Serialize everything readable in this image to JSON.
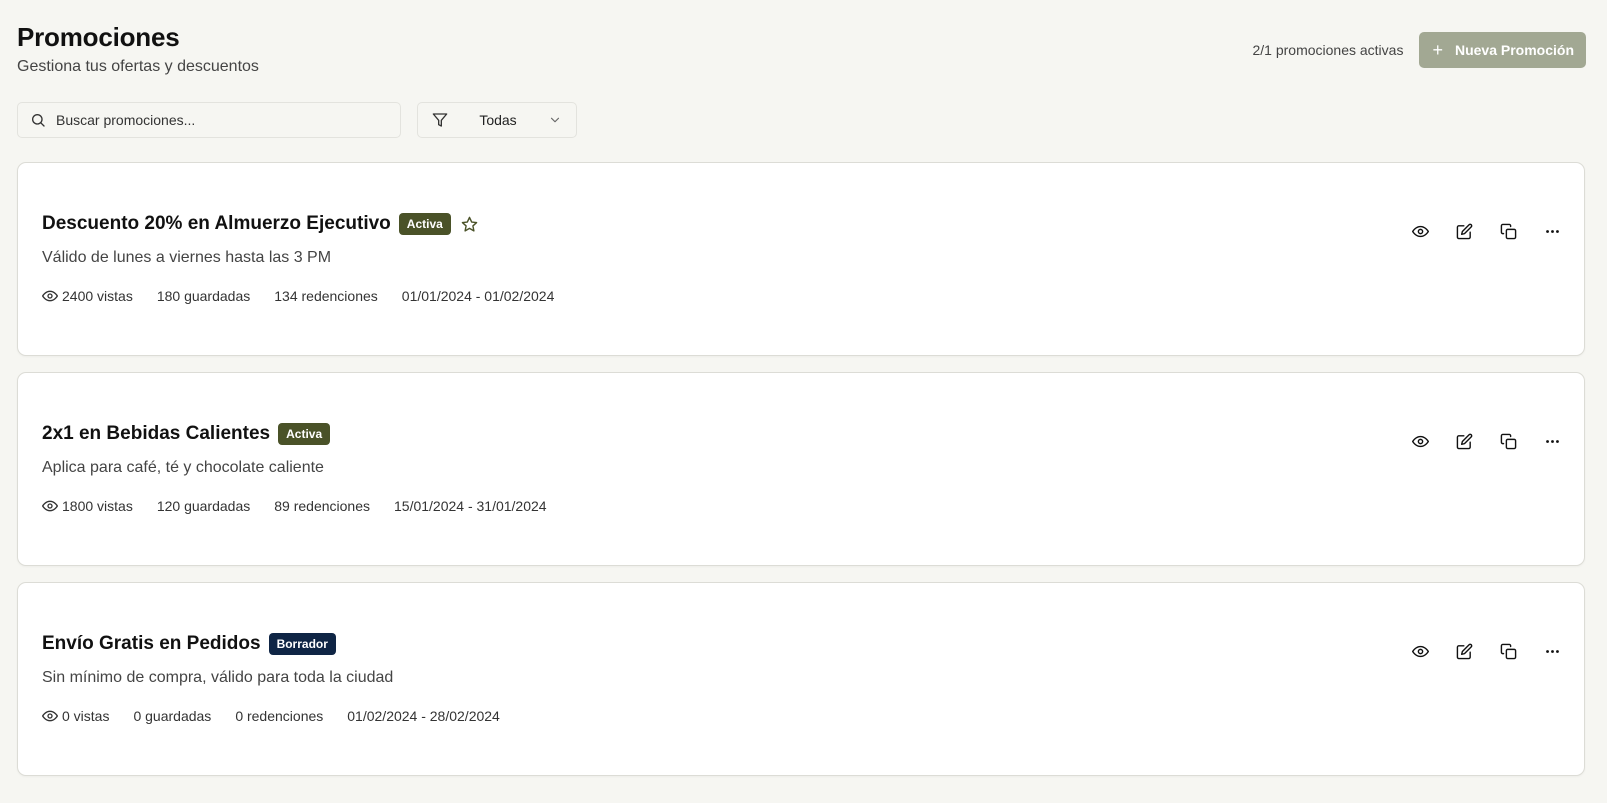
{
  "header": {
    "title": "Promociones",
    "subtitle": "Gestiona tus ofertas y descuentos",
    "active_count": "2/1 promociones activas",
    "new_button_label": "Nueva Promoción",
    "new_button_color": "#a2a893"
  },
  "toolbar": {
    "search_placeholder": "Buscar promociones...",
    "search_value": "",
    "filter_value": "Todas"
  },
  "colors": {
    "badge_activa": "#4a5228",
    "badge_borrador": "#0f2545",
    "background": "#f6f6f2"
  },
  "promotions": [
    {
      "title": "Descuento 20% en Almuerzo Ejecutivo",
      "status": "Activa",
      "featured": true,
      "description": "Válido de lunes a viernes hasta las 3 PM",
      "views": "2400 vistas",
      "saved": "180 guardadas",
      "redemptions": "134 redenciones",
      "dates": "01/01/2024 - 01/02/2024"
    },
    {
      "title": "2x1 en Bebidas Calientes",
      "status": "Activa",
      "featured": false,
      "description": "Aplica para café, té y chocolate caliente",
      "views": "1800 vistas",
      "saved": "120 guardadas",
      "redemptions": "89 redenciones",
      "dates": "15/01/2024 - 31/01/2024"
    },
    {
      "title": "Envío Gratis en Pedidos",
      "status": "Borrador",
      "featured": false,
      "description": "Sin mínimo de compra, válido para toda la ciudad",
      "views": "0 vistas",
      "saved": "0 guardadas",
      "redemptions": "0 redenciones",
      "dates": "01/02/2024 - 28/02/2024"
    }
  ],
  "icons": {
    "search": "search-icon",
    "filter": "filter-icon",
    "chevron": "chevron-down-icon",
    "plus": "plus-icon",
    "star": "star-icon",
    "eye": "eye-icon",
    "edit": "edit-icon",
    "copy": "copy-icon",
    "more": "more-icon"
  }
}
